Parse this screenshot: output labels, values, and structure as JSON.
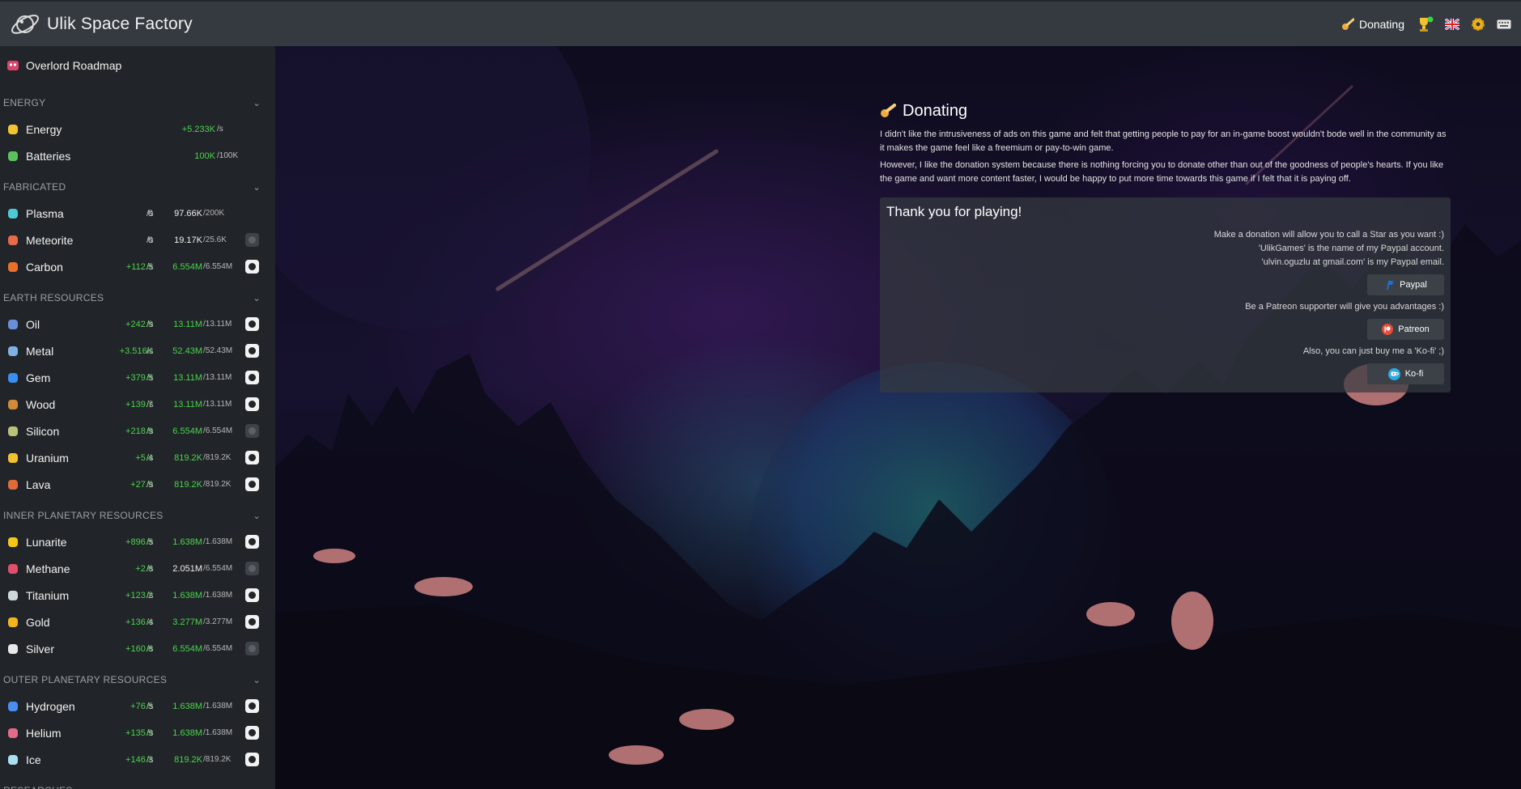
{
  "app": {
    "title": "Ulik Space Factory"
  },
  "topbar": {
    "donating_label": "Donating",
    "icons": [
      "planet-logo-icon",
      "comet-icon",
      "trophy-icon",
      "uk-flag-icon",
      "gear-icon",
      "keyboard-icon"
    ]
  },
  "sidebar": {
    "roadmap_label": "Overlord Roadmap",
    "sections": [
      {
        "title": "ENERGY",
        "rows": [
          {
            "name": "Energy",
            "prod": "+5.233K",
            "unit": "/s",
            "amount": "",
            "max": "",
            "icon": "lightning-icon"
          },
          {
            "name": "Batteries",
            "prod": "100K",
            "unit": "/100K",
            "amount": "",
            "max": "",
            "icon": "battery-icon"
          }
        ]
      },
      {
        "title": "FABRICATED",
        "rows": [
          {
            "name": "Plasma",
            "prod": "0",
            "unit": "/s",
            "amount": "97.66K",
            "max": "/200K",
            "icon": "plasma-icon"
          },
          {
            "name": "Meteorite",
            "prod": "0",
            "unit": "/s",
            "amount": "19.17K",
            "max": "/25.6K",
            "icon": "meteorite-icon"
          },
          {
            "name": "Carbon",
            "prod": "+112.5",
            "unit": "/s",
            "amount": "6.554M",
            "max": "/6.554M",
            "icon": "carbon-icon"
          }
        ]
      },
      {
        "title": "EARTH RESOURCES",
        "rows": [
          {
            "name": "Oil",
            "prod": "+242.9",
            "unit": "/s",
            "amount": "13.11M",
            "max": "/13.11M",
            "icon": "oil-icon"
          },
          {
            "name": "Metal",
            "prod": "+3.516K",
            "unit": "/s",
            "amount": "52.43M",
            "max": "/52.43M",
            "icon": "metal-icon"
          },
          {
            "name": "Gem",
            "prod": "+379.5",
            "unit": "/s",
            "amount": "13.11M",
            "max": "/13.11M",
            "icon": "gem-icon"
          },
          {
            "name": "Wood",
            "prod": "+139.7",
            "unit": "/s",
            "amount": "13.11M",
            "max": "/13.11M",
            "icon": "wood-icon"
          },
          {
            "name": "Silicon",
            "prod": "+218.9",
            "unit": "/s",
            "amount": "6.554M",
            "max": "/6.554M",
            "icon": "silicon-icon"
          },
          {
            "name": "Uranium",
            "prod": "+5.4",
            "unit": "/s",
            "amount": "819.2K",
            "max": "/819.2K",
            "icon": "uranium-icon"
          },
          {
            "name": "Lava",
            "prod": "+27.9",
            "unit": "/s",
            "amount": "819.2K",
            "max": "/819.2K",
            "icon": "lava-icon"
          }
        ]
      },
      {
        "title": "INNER PLANETARY RESOURCES",
        "rows": [
          {
            "name": "Lunarite",
            "prod": "+896.5",
            "unit": "/s",
            "amount": "1.638M",
            "max": "/1.638M",
            "icon": "lunarite-icon"
          },
          {
            "name": "Methane",
            "prod": "+2.6",
            "unit": "/s",
            "amount": "2.051M",
            "max": "/6.554M",
            "icon": "methane-icon"
          },
          {
            "name": "Titanium",
            "prod": "+123.2",
            "unit": "/s",
            "amount": "1.638M",
            "max": "/1.638M",
            "icon": "titanium-icon"
          },
          {
            "name": "Gold",
            "prod": "+136.4",
            "unit": "/s",
            "amount": "3.277M",
            "max": "/3.277M",
            "icon": "gold-icon"
          },
          {
            "name": "Silver",
            "prod": "+160.6",
            "unit": "/s",
            "amount": "6.554M",
            "max": "/6.554M",
            "icon": "silver-icon"
          }
        ]
      },
      {
        "title": "OUTER PLANETARY RESOURCES",
        "rows": [
          {
            "name": "Hydrogen",
            "prod": "+76.5",
            "unit": "/s",
            "amount": "1.638M",
            "max": "/1.638M",
            "icon": "hydrogen-icon"
          },
          {
            "name": "Helium",
            "prod": "+135.9",
            "unit": "/s",
            "amount": "1.638M",
            "max": "/1.638M",
            "icon": "helium-icon"
          },
          {
            "name": "Ice",
            "prod": "+146.3",
            "unit": "/s",
            "amount": "819.2K",
            "max": "/819.2K",
            "icon": "ice-icon"
          }
        ]
      },
      {
        "title": "RESEARCHES",
        "rows": []
      }
    ]
  },
  "main": {
    "title": "Donating",
    "paragraphs": [
      "I didn't like the intrusiveness of ads on this game and felt that getting people to pay for an in-game boost wouldn't bode well in the community as it makes the game feel like a freemium or pay-to-win game.",
      "However, I like the donation system because there is nothing forcing you to donate other than out of the goodness of people's hearts. If you like the game and want more content faster, I would be happy to put more time towards this game if I felt that it is paying off."
    ],
    "card": {
      "title": "Thank you for playing!",
      "paypal_lines": [
        "Make a donation will allow you to call a Star as you want :)",
        "'UlikGames' is the name of my Paypal account.",
        "'ulvin.oguzlu at gmail.com' is my Paypal email."
      ],
      "paypal_button": "Paypal",
      "patreon_line": "Be a Patreon supporter will give you advantages :)",
      "patreon_button": "Patreon",
      "kofi_line": "Also, you can just buy me a 'Ko-fi' ;)",
      "kofi_button": "Ko-fi"
    }
  },
  "colors": {
    "topbar": "#343a40",
    "sidebar": "#212529",
    "accent_green": "#49d44a",
    "card": "#343a40"
  }
}
